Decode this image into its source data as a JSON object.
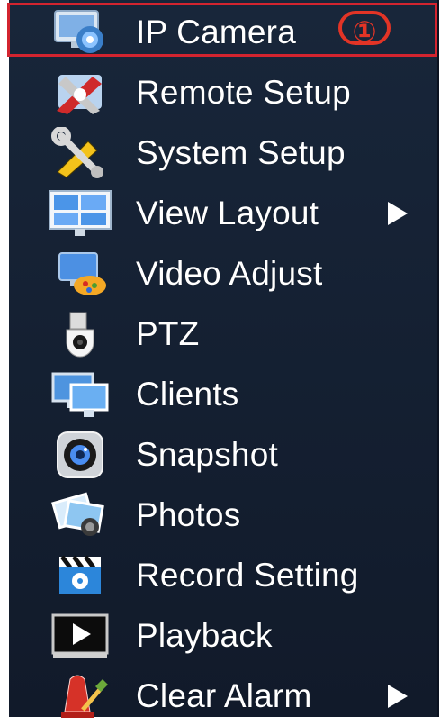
{
  "menu": {
    "items": [
      {
        "label": "IP Camera",
        "icon": "ip-camera-icon",
        "submenu": false,
        "highlighted": true
      },
      {
        "label": "Remote Setup",
        "icon": "remote-setup-icon",
        "submenu": false,
        "highlighted": false
      },
      {
        "label": "System Setup",
        "icon": "system-setup-icon",
        "submenu": false,
        "highlighted": false
      },
      {
        "label": "View Layout",
        "icon": "view-layout-icon",
        "submenu": true,
        "highlighted": false
      },
      {
        "label": "Video Adjust",
        "icon": "video-adjust-icon",
        "submenu": false,
        "highlighted": false
      },
      {
        "label": "PTZ",
        "icon": "ptz-icon",
        "submenu": false,
        "highlighted": false
      },
      {
        "label": "Clients",
        "icon": "clients-icon",
        "submenu": false,
        "highlighted": false
      },
      {
        "label": "Snapshot",
        "icon": "snapshot-icon",
        "submenu": false,
        "highlighted": false
      },
      {
        "label": "Photos",
        "icon": "photos-icon",
        "submenu": false,
        "highlighted": false
      },
      {
        "label": "Record Setting",
        "icon": "record-setting-icon",
        "submenu": false,
        "highlighted": false
      },
      {
        "label": "Playback",
        "icon": "playback-icon",
        "submenu": false,
        "highlighted": false
      },
      {
        "label": "Clear Alarm",
        "icon": "clear-alarm-icon",
        "submenu": true,
        "highlighted": false
      }
    ]
  },
  "annotation": {
    "callout_number": "①"
  },
  "colors": {
    "menu_background": "#16233a",
    "text": "#ffffff",
    "highlight_border": "#d3242f"
  }
}
